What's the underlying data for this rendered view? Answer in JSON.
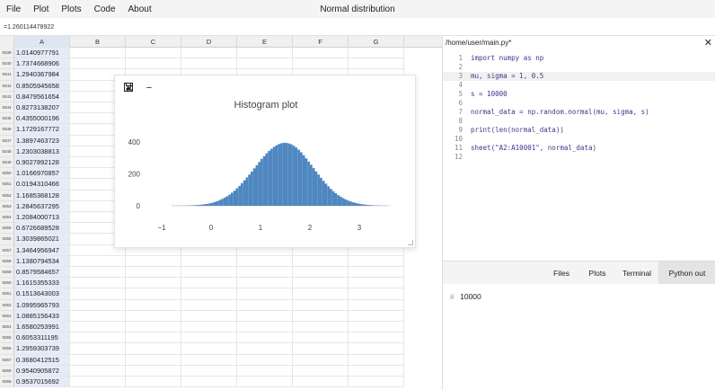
{
  "menubar": {
    "items": [
      "File",
      "Plot",
      "Plots",
      "Code",
      "About"
    ],
    "title": "Normal distribution"
  },
  "formula_bar": {
    "value": "=1.260114478922"
  },
  "sheet": {
    "columns": [
      "A",
      "B",
      "C",
      "D",
      "E",
      "F",
      "G"
    ],
    "selected_column": "A",
    "rows": [
      {
        "num": "9339",
        "A": "1.0140977791"
      },
      {
        "num": "9340",
        "A": "1.7374668906"
      },
      {
        "num": "9341",
        "A": "1.2940367984"
      },
      {
        "num": "9342",
        "A": "0.8505945658"
      },
      {
        "num": "9343",
        "A": "0.8479561654"
      },
      {
        "num": "9344",
        "A": "0.8273138207"
      },
      {
        "num": "9345",
        "A": "0.4355000196"
      },
      {
        "num": "9346",
        "A": "1.1729167772"
      },
      {
        "num": "9347",
        "A": "1.3897463723"
      },
      {
        "num": "9348",
        "A": "1.2303038813"
      },
      {
        "num": "9349",
        "A": "0.9027892128"
      },
      {
        "num": "9350",
        "A": "1.0166970857"
      },
      {
        "num": "9351",
        "A": "0.0194310466"
      },
      {
        "num": "9352",
        "A": "1.1685368128"
      },
      {
        "num": "9353",
        "A": "1.2845637295"
      },
      {
        "num": "9354",
        "A": "1.2084000713"
      },
      {
        "num": "9355",
        "A": "0.6726689528"
      },
      {
        "num": "9356",
        "A": "1.3039865021"
      },
      {
        "num": "9357",
        "A": "1.3464956947"
      },
      {
        "num": "9358",
        "A": "1.1380794534"
      },
      {
        "num": "9359",
        "A": "0.8579584657"
      },
      {
        "num": "9360",
        "A": "1.1615355333"
      },
      {
        "num": "9361",
        "A": "0.1513643003"
      },
      {
        "num": "9362",
        "A": "1.0995965793"
      },
      {
        "num": "9363",
        "A": "1.0885156433"
      },
      {
        "num": "9364",
        "A": "1.6580253991"
      },
      {
        "num": "9365",
        "A": "0.6053311195"
      },
      {
        "num": "9366",
        "A": "1.2959303739"
      },
      {
        "num": "9367",
        "A": "0.3680412515"
      },
      {
        "num": "9368",
        "A": "0.9540905872"
      },
      {
        "num": "9369",
        "A": "0.9537015692"
      }
    ]
  },
  "dialog": {
    "tools": {
      "close": "✕",
      "minimize": "−",
      "save": "💾"
    },
    "title": "Histogram plot"
  },
  "chart_data": {
    "type": "bar",
    "title": "Histogram plot",
    "xlabel": "",
    "ylabel": "",
    "xlim": [
      -1.4,
      3.6
    ],
    "ylim": [
      0,
      480
    ],
    "xticks": [
      -1,
      0,
      1,
      2,
      3
    ],
    "yticks": [
      0,
      200,
      400
    ],
    "bar_color": "#4f87c0",
    "bin_width": 0.05,
    "bin_start": -0.8,
    "values": [
      1,
      0,
      1,
      1,
      1,
      1,
      2,
      2,
      3,
      4,
      5,
      6,
      8,
      10,
      12,
      15,
      19,
      24,
      29,
      36,
      43,
      51,
      60,
      70,
      82,
      95,
      110,
      125,
      142,
      160,
      178,
      196,
      215,
      235,
      255,
      275,
      295,
      312,
      330,
      345,
      358,
      370,
      380,
      388,
      393,
      396,
      395,
      392,
      386,
      377,
      366,
      352,
      336,
      318,
      298,
      278,
      258,
      237,
      216,
      196,
      176,
      157,
      139,
      122,
      106,
      92,
      79,
      67,
      57,
      48,
      40,
      33,
      27,
      22,
      18,
      14,
      11,
      9,
      7,
      5,
      4,
      3,
      2,
      2,
      1,
      1,
      1,
      0,
      1
    ]
  },
  "editor": {
    "file_path": "/home/user/main.py*",
    "close": "✕",
    "active_line": 3,
    "lines": [
      {
        "n": "1",
        "text": "import numpy as np"
      },
      {
        "n": "2",
        "text": ""
      },
      {
        "n": "3",
        "text": "mu, sigma = 1, 0.5"
      },
      {
        "n": "4",
        "text": ""
      },
      {
        "n": "5",
        "text": "s = 10000"
      },
      {
        "n": "6",
        "text": ""
      },
      {
        "n": "7",
        "text": "normal_data = np.random.normal(mu, sigma, s)"
      },
      {
        "n": "8",
        "text": ""
      },
      {
        "n": "9",
        "text": "print(len(normal_data))"
      },
      {
        "n": "10",
        "text": ""
      },
      {
        "n": "11",
        "text": "sheet(\"A2:A10001\", normal_data)"
      },
      {
        "n": "12",
        "text": ""
      }
    ]
  },
  "bottom_panel": {
    "tabs": [
      "Files",
      "Plots",
      "Terminal",
      "Python out"
    ],
    "active_tab": "Python out",
    "output_prompt": "#",
    "output": "10000"
  }
}
